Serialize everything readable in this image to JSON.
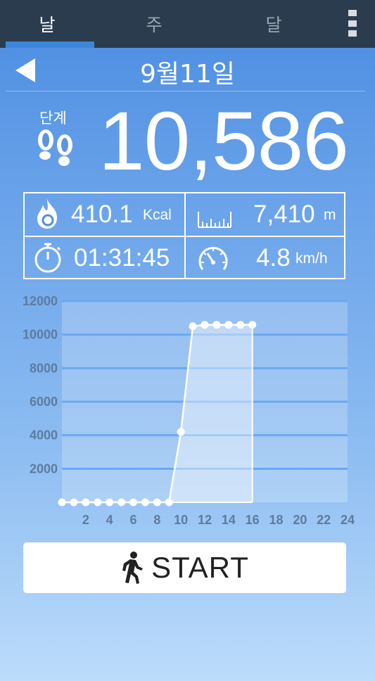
{
  "tabs": [
    {
      "label": "날",
      "active": true
    },
    {
      "label": "주",
      "active": false
    },
    {
      "label": "달",
      "active": false
    }
  ],
  "header": {
    "date": "9월11일"
  },
  "steps": {
    "label": "단계",
    "value": "10,586"
  },
  "stats": {
    "calories": {
      "value": "410.1",
      "unit": "Kcal",
      "icon": "flame-icon"
    },
    "distance": {
      "value": "7,410",
      "unit": "m",
      "icon": "ruler-icon"
    },
    "duration": {
      "value": "01:31:45",
      "icon": "stopwatch-icon"
    },
    "speed": {
      "value": "4.8",
      "unit": "km/h",
      "icon": "speedometer-icon"
    }
  },
  "start_button": {
    "label": "START",
    "icon": "walking-person-icon"
  },
  "colors": {
    "tabbar": "#2b3c4f",
    "tab_indicator": "#3c86da",
    "axis_text": "#5d7c9f"
  },
  "chart_data": {
    "type": "area",
    "x": [
      0,
      1,
      2,
      3,
      4,
      5,
      6,
      7,
      8,
      9,
      10,
      11,
      12,
      13,
      14,
      15,
      16
    ],
    "values": [
      0,
      0,
      0,
      0,
      0,
      0,
      0,
      0,
      0,
      0,
      4200,
      10500,
      10586,
      10586,
      10586,
      10586,
      10586
    ],
    "x_ticks": [
      "2",
      "4",
      "6",
      "8",
      "10",
      "12",
      "14",
      "16",
      "18",
      "20",
      "22",
      "24"
    ],
    "y_ticks": [
      "2000",
      "4000",
      "6000",
      "8000",
      "10000",
      "12000"
    ],
    "xlim": [
      0,
      24
    ],
    "ylim": [
      0,
      12000
    ],
    "grid": true
  }
}
